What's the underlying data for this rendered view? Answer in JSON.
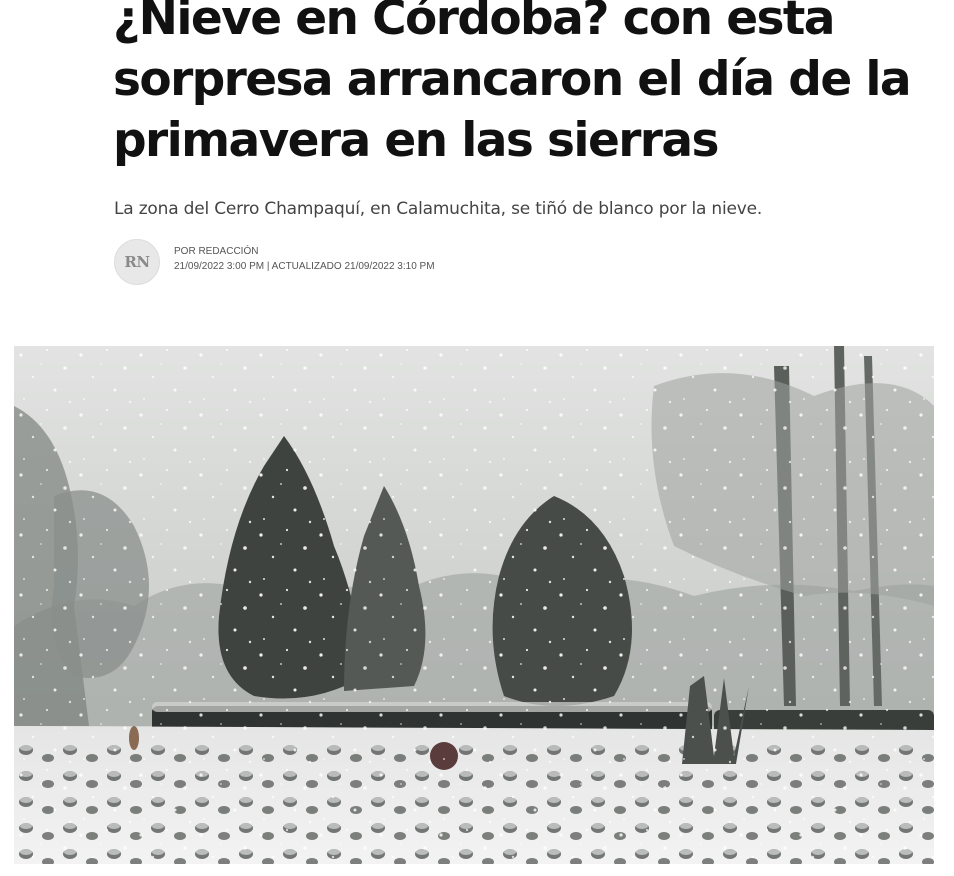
{
  "article": {
    "headline_lines": [
      "¿Nieve en Córdoba? con esta",
      "sorpresa arrancaron el día de la",
      "primavera en las sierras"
    ],
    "subtitle": "La zona del Cerro Champaquí, en Calamuchita, se tiñó de blanco por la nieve.",
    "byline": {
      "avatar_initials": "RN",
      "author": "POR REDACCIÓN",
      "dates": "21/09/2022 3:00 PM | ACTUALIZADO 21/09/2022 3:10 PM"
    },
    "photo": {
      "scene": "snowfall-garden",
      "sky_color": "#d9dad9",
      "snow_color": "#f2f2f2",
      "tree_color": "#3f4340",
      "hedge_color": "#2f3331"
    }
  }
}
